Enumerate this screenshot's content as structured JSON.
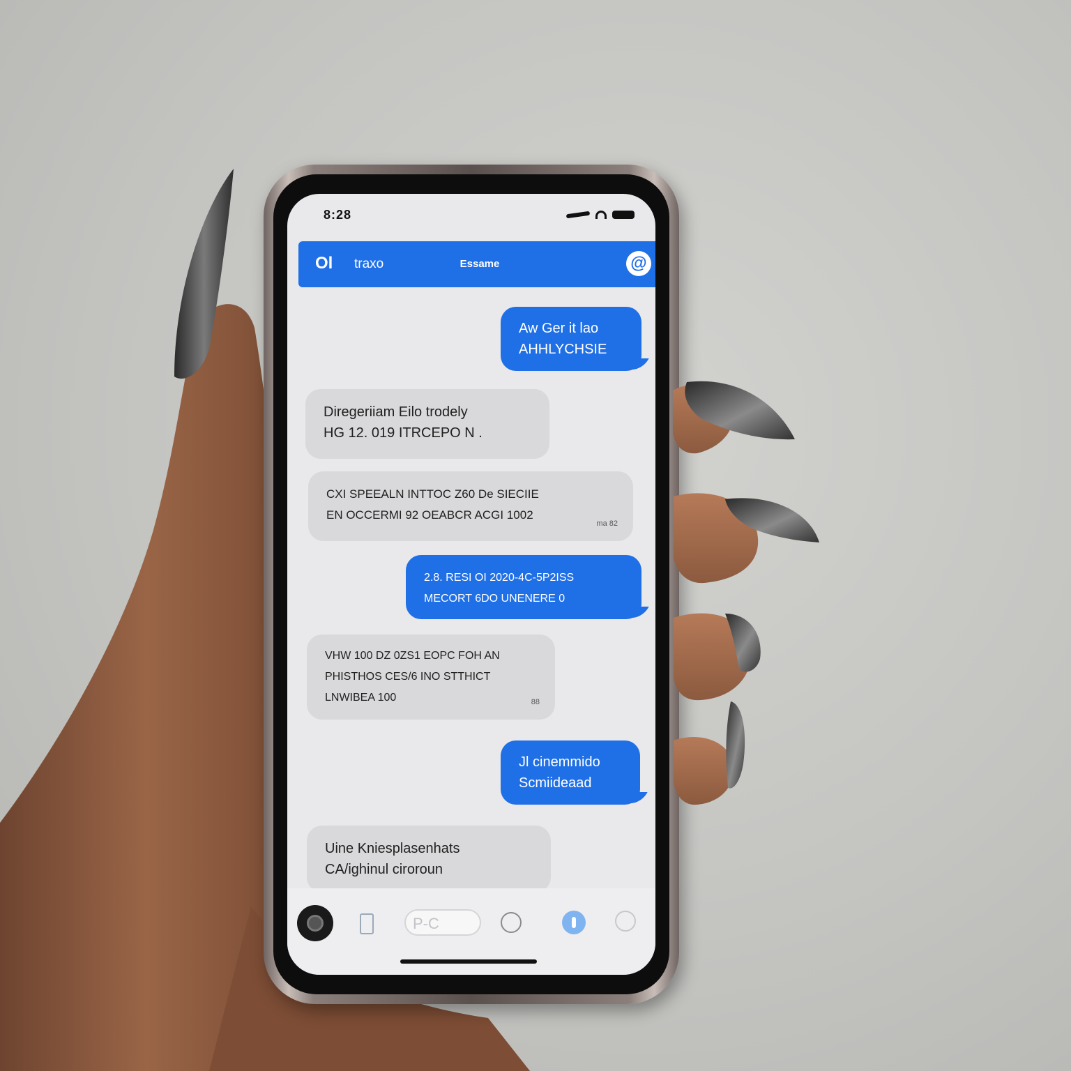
{
  "status_bar": {
    "time": "8:28"
  },
  "header": {
    "back_icon": "Ol",
    "back_label": "traxo",
    "title": "Essame",
    "at_icon": "@"
  },
  "messages": [
    {
      "type": "sent",
      "lines": [
        "Aw Ger it lao",
        "AHHLYCHSIE"
      ]
    },
    {
      "type": "received",
      "lines": [
        "Diregeriiam Eilo trodely",
        "HG 12. 019 ITRCEPO N ."
      ]
    },
    {
      "type": "received",
      "lines": [
        "CXI SPEEALN INTTOC Z60 De SIECIIE",
        "EN OCCERMI 92 OEABCR ACGI 1002"
      ],
      "stamp": "ma 82"
    },
    {
      "type": "sent",
      "lines": [
        "2.8. RESI OI 2020-4C-5P2ISS",
        "MECORT 6DO UNENERE 0"
      ]
    },
    {
      "type": "received",
      "lines": [
        "VHW 100 DZ 0ZS1 EOPC FOH AN",
        "PHISTHOS CES/6 INO STTHICT",
        "LNWIBEA 100"
      ],
      "stamp": "88"
    },
    {
      "type": "sent",
      "lines": [
        "Jl cinemmido",
        "Scmiideaad"
      ]
    },
    {
      "type": "received",
      "lines": [
        "Uine Kniesplasenhats",
        "CA/ighinul ciroroun"
      ]
    }
  ],
  "input": {
    "icons": [
      "camera-icon",
      "apps-icon",
      "circle-icon",
      "mic-icon",
      "emoji-icon"
    ],
    "field_text": "P-C"
  },
  "colors": {
    "accent": "#1f6fe6",
    "received_bubble": "#d9d9db",
    "screen_bg": "#e9e9eb",
    "skin": "#8a5a3c",
    "nail": "#3a3a3a"
  }
}
